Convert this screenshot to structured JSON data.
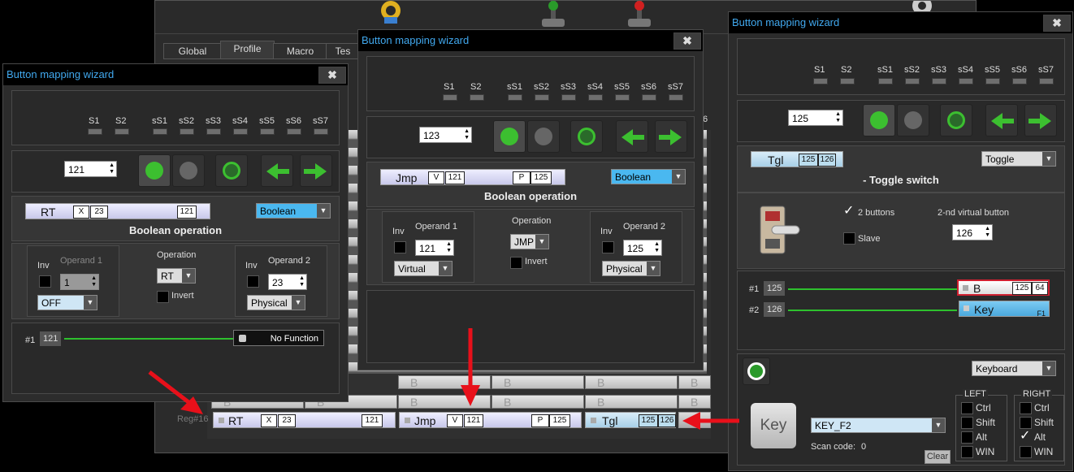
{
  "background": {
    "tabs": [
      "Global",
      "Profile",
      "Macro",
      "Tes"
    ],
    "row_label": "Reg#16",
    "row": {
      "cell1": {
        "text": "RT",
        "tag": "X",
        "val": "23",
        "val2": "121"
      },
      "cell2": {
        "text": "Jmp",
        "tag": "V",
        "val": "121",
        "tag2": "P",
        "val2": "125"
      },
      "cell3": {
        "text": "Tgl",
        "val": "125",
        "val2": "126"
      }
    },
    "cell_b": "B",
    "col_header": "6"
  },
  "dlg1": {
    "title": "Button mapping wizard",
    "close": "✖",
    "shifts": [
      "S1",
      "S2",
      "sS1",
      "sS2",
      "sS3",
      "sS4",
      "sS5",
      "sS6",
      "sS7"
    ],
    "spin": "121",
    "map": {
      "text": "RT",
      "tag": "X",
      "val": "23",
      "val2": "121"
    },
    "type": "Boolean",
    "heading": "Boolean operation",
    "inv1": "Inv",
    "op1_label": "Operand 1",
    "op1_value": "1",
    "op1_type": "OFF",
    "operation_label": "Operation",
    "operation": "RT",
    "invert": "Invert",
    "inv2": "Inv",
    "op2_label": "Operand 2",
    "op2_value": "23",
    "op2_type": "Physical",
    "line_label": "#1",
    "line_num": "121",
    "target": "No Function"
  },
  "dlg2": {
    "title": "Button mapping wizard",
    "close": "✖",
    "shifts": [
      "S1",
      "S2",
      "sS1",
      "sS2",
      "sS3",
      "sS4",
      "sS5",
      "sS6",
      "sS7"
    ],
    "spin": "123",
    "map": {
      "text": "Jmp",
      "tag": "V",
      "val": "121",
      "tag2": "P",
      "val2": "125"
    },
    "type": "Boolean",
    "heading": "Boolean operation",
    "inv1": "Inv",
    "op1_label": "Operand 1",
    "op1_value": "121",
    "op1_type": "Virtual",
    "operation_label": "Operation",
    "operation": "JMP",
    "invert": "Invert",
    "inv2": "Inv",
    "op2_label": "Operand 2",
    "op2_value": "125",
    "op2_type": "Physical"
  },
  "dlg3": {
    "title": "Button mapping wizard",
    "close": "✖",
    "shifts": [
      "S1",
      "S2",
      "sS1",
      "sS2",
      "sS3",
      "sS4",
      "sS5",
      "sS6",
      "sS7"
    ],
    "spin": "125",
    "map": {
      "text": "Tgl",
      "val": "125",
      "val2": "126"
    },
    "type": "Toggle",
    "heading": "- Toggle switch",
    "two_buttons": "2 buttons",
    "slave": "Slave",
    "second_label": "2-nd virtual button",
    "second_value": "126",
    "line1_label": "#1",
    "line1_num": "125",
    "line2_label": "#2",
    "line2_num": "126",
    "target1": {
      "text": "B",
      "val": "125",
      "val2": "64"
    },
    "target2": {
      "text": "Key",
      "sub": "F1"
    },
    "action_type": "Keyboard",
    "keycap": "Key",
    "key_value": "KEY_F2",
    "scan_label": "Scan code:",
    "scan_value": "0",
    "clear": "Clear",
    "left_title": "LEFT",
    "right_title": "RIGHT",
    "mods": [
      "Ctrl",
      "Shift",
      "Alt",
      "WIN"
    ],
    "right_alt_checked": "✓",
    "check_mark": "✓"
  }
}
